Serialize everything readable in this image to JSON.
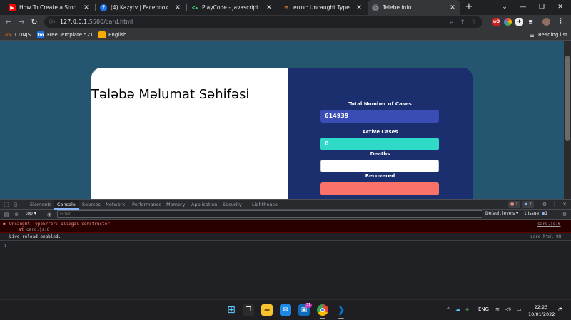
{
  "tabs": [
    {
      "label": "How To Create a Stopwatch |",
      "favicon": "youtube-icon",
      "color": "#ff0000"
    },
    {
      "label": "(4) Kazytv | Facebook",
      "favicon": "facebook-icon",
      "color": "#1877f2"
    },
    {
      "label": "PlayCode - Javascript Playgr",
      "favicon": "playcode-icon",
      "color": "#3ddc84"
    },
    {
      "label": "error: Uncaught TypeError: Il",
      "favicon": "stackoverflow-icon",
      "color": "#f48024"
    },
    {
      "label": "Telebe info",
      "favicon": "globe-icon",
      "color": "#9aa0a6",
      "active": true
    }
  ],
  "toolbar": {
    "url_host": "127.0.0.1",
    "url_rest": ":5500/card.html"
  },
  "bookmarks": [
    {
      "label": "CDNJS",
      "icon": "cdnjs-icon"
    },
    {
      "label": "Free Template 521...",
      "icon": "tm-icon",
      "badge": "tm"
    },
    {
      "label": "English",
      "icon": "folder-icon"
    }
  ],
  "reading_list": "Reading list",
  "page": {
    "title": "Tələbə Məlumat Səhifəsi",
    "stats": [
      {
        "label": "Total Number of Cases",
        "value": "614939"
      },
      {
        "label": "Active Cases",
        "value": "0"
      },
      {
        "label": "Deaths",
        "value": ""
      },
      {
        "label": "Recovered",
        "value": ""
      }
    ]
  },
  "devtools": {
    "tabs": [
      "Elements",
      "Console",
      "Sources",
      "Network",
      "Performance",
      "Memory",
      "Application",
      "Security",
      "Lighthouse"
    ],
    "active_tab": "Console",
    "error_badge": "1",
    "message_badge": "1",
    "context": "top",
    "filter_placeholder": "Filter",
    "default_levels": "Default levels",
    "issues": "1 Issue:",
    "issues_count": "1"
  },
  "console": {
    "error_message": "Uncaught TypeError: Illegal constructor",
    "error_at": "at",
    "error_link": "card.js:6",
    "error_source": "card.js:6",
    "log_message": "Live reload enabled.",
    "log_source": "card.html:98"
  },
  "taskbar": {
    "lang": "ENG",
    "time": "22:23",
    "date": "10/01/2022",
    "store_badge": "31"
  }
}
